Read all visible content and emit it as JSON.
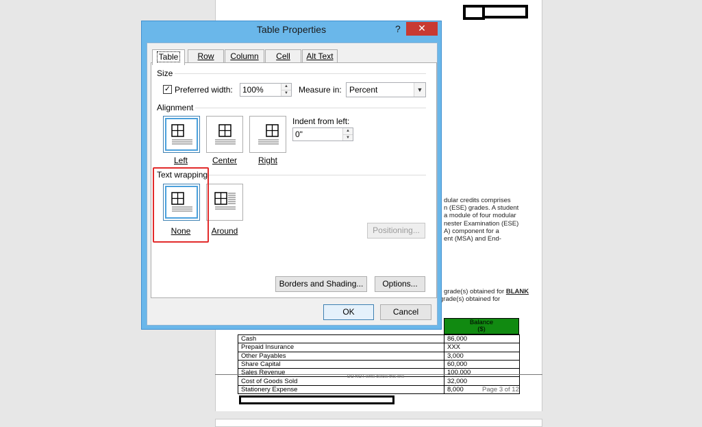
{
  "document": {
    "text_lines": [
      "dular credits comprises",
      "n (ESE) grades. A student",
      "a module of four modular",
      "nester Examination (ESE)",
      "A) component for a",
      "ent (MSA) and End-"
    ],
    "line2_prefix": "grade(s) obtained for ",
    "line2_bold": "BLANK",
    "line3": "grade(s) obtained for",
    "balance_header": "Balance\n($)",
    "ledger_rows": [
      {
        "account": "Cash",
        "balance": "86,000"
      },
      {
        "account": "Prepaid Insurance",
        "balance": "XXX"
      },
      {
        "account": "Other Payables",
        "balance": "3,000"
      },
      {
        "account": "Share Capital",
        "balance": "60,000"
      },
      {
        "account": "Sales Revenue",
        "balance": "100,000"
      },
      {
        "account": "Cost of Goods Sold",
        "balance": "32,000"
      },
      {
        "account": "Stationery Expense",
        "balance": "8,000"
      }
    ],
    "do_not_write": "DO NOT write below this line",
    "page_number": "Page 3 of 12"
  },
  "dialog": {
    "title": "Table Properties",
    "help": "?",
    "close": "✕",
    "tabs": [
      "Table",
      "Row",
      "Column",
      "Cell",
      "Alt Text"
    ],
    "size_label": "Size",
    "preferred_width_label": "Preferred width:",
    "preferred_width_checked": true,
    "preferred_width_value": "100%",
    "measure_in_label": "Measure in:",
    "measure_in_value": "Percent",
    "alignment_label": "Alignment",
    "alignment_options": [
      "Left",
      "Center",
      "Right"
    ],
    "alignment_selected": "Left",
    "indent_label": "Indent from left:",
    "indent_value": "0\"",
    "text_wrapping_label": "Text wrapping",
    "wrapping_options": [
      "None",
      "Around"
    ],
    "wrapping_selected": "None",
    "positioning_button": "Positioning...",
    "borders_button": "Borders and Shading...",
    "options_button": "Options...",
    "ok_button": "OK",
    "cancel_button": "Cancel"
  },
  "colors": {
    "title_bar": "#6ab7ea",
    "close_button": "#c83a32",
    "highlight_border": "#e22a2a",
    "table_header": "#118a11"
  }
}
